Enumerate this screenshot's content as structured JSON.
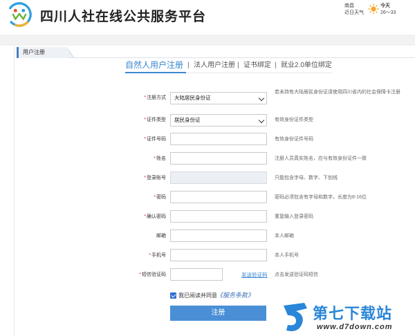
{
  "header": {
    "site_title": "四川人社在线公共服务平台",
    "weather": {
      "city": "南昌",
      "recent_label": "近日天气",
      "today_label": "今天",
      "temperature": "26～33"
    }
  },
  "breadcrumb": {
    "label": "用户注册"
  },
  "tabs": [
    {
      "label": "自然人用户注册",
      "active": true
    },
    {
      "label": "法人用户注册",
      "active": false
    },
    {
      "label": "证书绑定",
      "active": false
    },
    {
      "label": "就业2.0单位绑定",
      "active": false
    }
  ],
  "tab_separator": "|",
  "form": {
    "required_mark": "*",
    "rows": [
      {
        "label": "注册方式",
        "required": true,
        "type": "select",
        "value": "大陆居民身份证",
        "hint": "若未持有大陆居民身份证请使用四川省内的社会保障卡注册"
      },
      {
        "label": "证件类型",
        "required": true,
        "type": "select",
        "value": "居民身份证",
        "hint": "有效身份证件类型"
      },
      {
        "label": "证件号码",
        "required": true,
        "type": "text",
        "value": "",
        "hint": "有效身份证件号码"
      },
      {
        "label": "姓名",
        "required": true,
        "type": "text",
        "value": "",
        "hint": "注册人员真实姓名，应与有效身份证件一致"
      },
      {
        "label": "登录账号",
        "required": true,
        "type": "disabled",
        "value": "",
        "hint": "只能包含字母、数字、下划线"
      },
      {
        "label": "密码",
        "required": true,
        "type": "password",
        "value": "",
        "hint": "密码必须包含有字母和数字，长度为8-16位"
      },
      {
        "label": "确认密码",
        "required": true,
        "type": "password",
        "value": "",
        "hint": "重复输入登录密码"
      },
      {
        "label": "邮箱",
        "required": false,
        "type": "text",
        "value": "",
        "hint": "本人邮箱"
      },
      {
        "label": "手机号",
        "required": true,
        "type": "text",
        "value": "",
        "hint": "本人手机号"
      },
      {
        "label": "短信验证码",
        "required": true,
        "type": "sms",
        "value": "",
        "hint": "点击发送验证码短信"
      }
    ],
    "send_code_label": "发送验证码",
    "agree": {
      "checked": true,
      "text": "我已阅读并同意",
      "terms_label": "《服务条款》"
    },
    "submit_label": "注册"
  },
  "watermark": {
    "title": "第七下载站",
    "url": "www.d7down.com"
  },
  "colors": {
    "accent": "#3a86d0",
    "required": "#d9252b",
    "button": "#4a8fd6"
  }
}
